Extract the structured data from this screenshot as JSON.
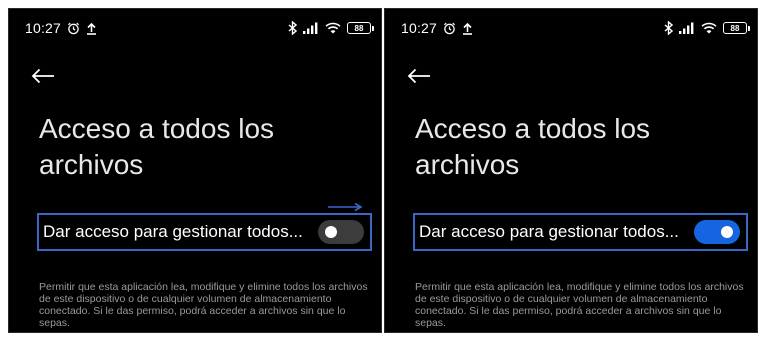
{
  "panels": [
    {
      "status_bar": {
        "time": "10:27",
        "battery": "88"
      },
      "title": "Acceso a todos los archivos",
      "toggle": {
        "label": "Dar acceso para gestionar todos...",
        "state": "off"
      },
      "description": "Permitir que esta aplicación lea, modifique y elimine todos los archivos de este dispositivo o de cualquier volumen de almacenamiento conectado. Si le das permiso, podrá acceder a archivos sin que lo sepas."
    },
    {
      "status_bar": {
        "time": "10:27",
        "battery": "88"
      },
      "title": "Acceso a todos los archivos",
      "toggle": {
        "label": "Dar acceso para gestionar todos...",
        "state": "on"
      },
      "description": "Permitir que esta aplicación lea, modifique y elimine todos los archivos de este dispositivo o de cualquier volumen de almacenamiento conectado. Si le das permiso, podrá acceder a archivos sin que lo sepas."
    }
  ],
  "colors": {
    "background": "#000000",
    "highlight_border": "#3a66c4",
    "switch_on": "#1565e0",
    "switch_off": "#3c3c3c",
    "description_text": "#9a9a9a"
  },
  "icons": [
    "alarm-icon",
    "upload-icon",
    "bluetooth-icon",
    "signal-icon",
    "wifi-icon",
    "battery-icon",
    "back-arrow-icon"
  ]
}
